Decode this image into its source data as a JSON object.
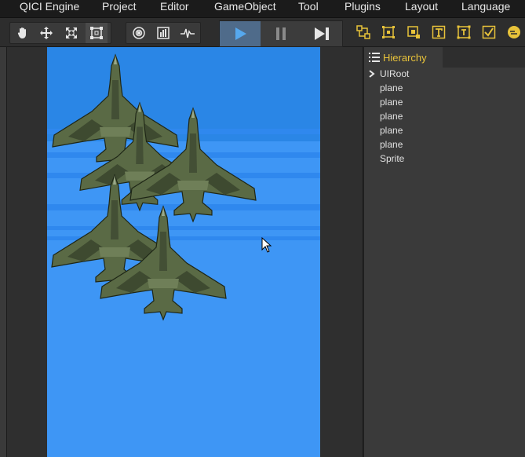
{
  "menubar": {
    "items": [
      "QICI Engine",
      "Project",
      "Editor",
      "GameObject",
      "Tool",
      "Plugins",
      "Layout",
      "Language"
    ]
  },
  "toolbar": {
    "transform_tools": [
      "hand-icon",
      "move-icon",
      "scale-icon",
      "rect-icon"
    ],
    "view_tools": [
      "zoom-icon",
      "stats-icon",
      "profiler-icon"
    ],
    "playback": [
      "play-icon",
      "pause-icon",
      "step-icon"
    ],
    "create_tools": [
      "node-icon",
      "sprite-icon",
      "image-icon",
      "text-icon",
      "ui-text-icon",
      "toggle-icon",
      "qc-icon"
    ],
    "accent_color": "#e8c33a",
    "play_color": "#56a8ee"
  },
  "hierarchy": {
    "tab_label": "Hierarchy",
    "items": [
      {
        "label": "UIRoot",
        "expandable": true
      },
      {
        "label": "plane",
        "expandable": false
      },
      {
        "label": "plane",
        "expandable": false
      },
      {
        "label": "plane",
        "expandable": false
      },
      {
        "label": "plane",
        "expandable": false
      },
      {
        "label": "plane",
        "expandable": false
      },
      {
        "label": "Sprite",
        "expandable": false
      }
    ]
  },
  "scene": {
    "background_color": "#3e96f5",
    "plane_count": 5
  }
}
